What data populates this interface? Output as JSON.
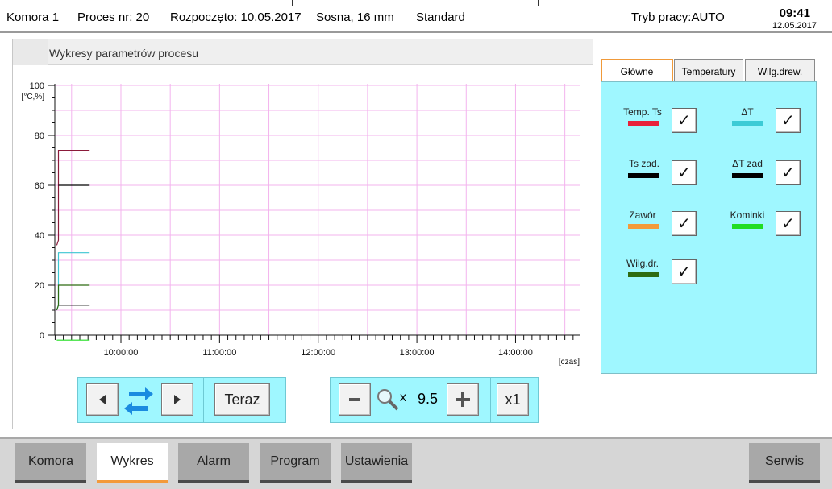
{
  "header": {
    "chamber": "Komora 1",
    "process": "Proces nr: 20",
    "started": "Rozpoczęto: 10.05.2017",
    "wood": "Sosna, 16 mm",
    "mode_name": "Standard",
    "work_mode": "Tryb pracy:AUTO",
    "time": "09:41",
    "date": "12.05.2017"
  },
  "chart_panel": {
    "title": "Wykresy parametrów procesu"
  },
  "chart_data": {
    "type": "line",
    "yunit": "[°C,%]",
    "xlabel": "[czas]",
    "ylim": [
      0,
      100
    ],
    "yticks": [
      0,
      20,
      40,
      60,
      80,
      100
    ],
    "xticks": [
      "10:00:00",
      "11:00:00",
      "12:00:00",
      "13:00:00",
      "14:00:00"
    ],
    "xlim_hours": [
      9.33,
      14.65
    ],
    "grid": true,
    "series": [
      {
        "name": "Temp. Ts",
        "color": "#8b1a3a",
        "x": [
          "09:21",
          "09:22",
          "09:22",
          "09:41"
        ],
        "y": [
          36,
          38,
          74,
          74
        ]
      },
      {
        "name": "Ts zad.",
        "color": "#000000",
        "x": [
          "09:22",
          "09:41"
        ],
        "y": [
          60,
          60
        ]
      },
      {
        "name": "ΔT",
        "color": "#3cc6d2",
        "x": [
          "09:21",
          "09:22",
          "09:22",
          "09:41"
        ],
        "y": [
          10,
          12,
          33,
          33
        ]
      },
      {
        "name": "ΔT zad",
        "color": "#000000",
        "x": [
          "09:22",
          "09:41"
        ],
        "y": [
          12,
          12
        ]
      },
      {
        "name": "Wilg.dr.",
        "color": "#2e6b12",
        "x": [
          "09:21",
          "09:22",
          "09:22",
          "09:41"
        ],
        "y": [
          10,
          12,
          20,
          20
        ]
      },
      {
        "name": "Kominki",
        "color": "#22dd22",
        "x": [
          "09:21",
          "09:41"
        ],
        "y": [
          -2,
          -2
        ]
      }
    ]
  },
  "nav_controls": {
    "now_label": "Teraz",
    "zoom_x": "x",
    "zoom_value": "9.5",
    "reset_label": "x1"
  },
  "legend": {
    "tabs": [
      "Główne",
      "Temperatury",
      "Wilg.drew."
    ],
    "items": [
      {
        "label": "Temp. Ts",
        "color": "#e8203a",
        "checked": "✓"
      },
      {
        "label": "ΔT",
        "color": "#3ccbd6",
        "checked": "✓"
      },
      {
        "label": "Ts zad.",
        "color": "#000000",
        "checked": "✓"
      },
      {
        "label": "ΔT zad",
        "color": "#000000",
        "checked": "✓"
      },
      {
        "label": "Zawór",
        "color": "#f39a3a",
        "checked": "✓"
      },
      {
        "label": "Kominki",
        "color": "#22dd22",
        "checked": "✓"
      },
      {
        "label": "Wilg.dr.",
        "color": "#2e6b12",
        "checked": "✓"
      }
    ]
  },
  "bottom_nav": {
    "items": [
      "Komora",
      "Wykres",
      "Alarm",
      "Program",
      "Ustawienia",
      "Serwis"
    ]
  }
}
